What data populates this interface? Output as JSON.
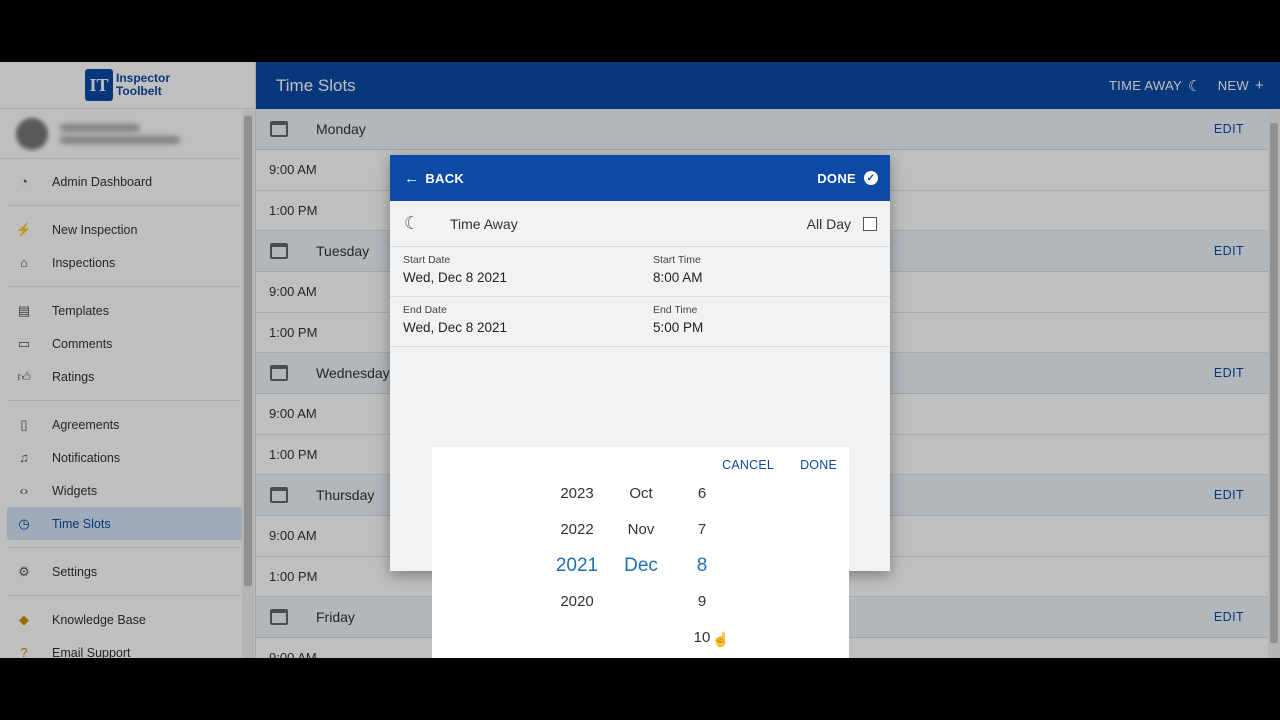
{
  "brand": {
    "line1": "Inspector",
    "line2": "Toolbelt",
    "mark": "IT"
  },
  "sidebar": {
    "items": [
      {
        "label": "Admin Dashboard",
        "icon": "dashboard-icon"
      },
      {
        "label": "New Inspection",
        "icon": "bolt-icon"
      },
      {
        "label": "Inspections",
        "icon": "home-icon"
      },
      {
        "label": "Templates",
        "icon": "document-icon"
      },
      {
        "label": "Comments",
        "icon": "comment-icon"
      },
      {
        "label": "Ratings",
        "icon": "thumbs-up-icon"
      },
      {
        "label": "Agreements",
        "icon": "agreement-icon"
      },
      {
        "label": "Notifications",
        "icon": "bell-icon"
      },
      {
        "label": "Widgets",
        "icon": "code-icon"
      },
      {
        "label": "Time Slots",
        "icon": "clock-icon",
        "active": true
      },
      {
        "label": "Settings",
        "icon": "gear-icon"
      },
      {
        "label": "Knowledge Base",
        "icon": "graduation-icon"
      },
      {
        "label": "Email Support",
        "icon": "help-icon"
      }
    ]
  },
  "header": {
    "title": "Time Slots",
    "time_away_label": "TIME AWAY",
    "new_label": "NEW"
  },
  "schedule": {
    "edit_label": "EDIT",
    "days": [
      {
        "name": "Monday",
        "slots": [
          "9:00 AM",
          "1:00 PM"
        ]
      },
      {
        "name": "Tuesday",
        "slots": [
          "9:00 AM",
          "1:00 PM"
        ]
      },
      {
        "name": "Wednesday",
        "slots": [
          "9:00 AM",
          "1:00 PM"
        ]
      },
      {
        "name": "Thursday",
        "slots": [
          "9:00 AM",
          "1:00 PM"
        ]
      },
      {
        "name": "Friday",
        "slots": [
          "9:00 AM"
        ]
      }
    ]
  },
  "dialog": {
    "back_label": "BACK",
    "done_label": "DONE",
    "time_away_label": "Time Away",
    "all_day_label": "All Day",
    "all_day_checked": false,
    "start_date_label": "Start Date",
    "start_date": "Wed, Dec 8 2021",
    "start_time_label": "Start Time",
    "start_time": "8:00 AM",
    "end_date_label": "End Date",
    "end_date": "Wed, Dec 8 2021",
    "end_time_label": "End Time",
    "end_time": "5:00 PM"
  },
  "picker": {
    "cancel_label": "CANCEL",
    "done_label": "DONE",
    "years": [
      "2023",
      "2022",
      "2021",
      "2020",
      ""
    ],
    "months": [
      "Oct",
      "Nov",
      "Dec",
      "",
      ""
    ],
    "days": [
      "6",
      "7",
      "8",
      "9",
      "10"
    ],
    "selected_index": 2
  },
  "colors": {
    "primary": "#0c4aa6",
    "selected": "#1f6fb5",
    "active_bg": "#d4e4f7"
  }
}
